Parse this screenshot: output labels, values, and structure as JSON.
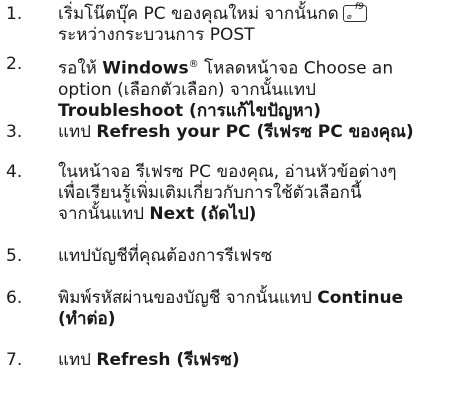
{
  "steps": [
    {
      "number": "1.",
      "lines": [
        {
          "text": "เริ่มโน๊ตบุ๊ค PC ของคุณใหม่ จากนั้นกด"
        },
        {
          "text": "ระหว่างกระบวนการ POST"
        }
      ],
      "key": {
        "label": "f9",
        "symbol": "⌀"
      }
    },
    {
      "number": "2.",
      "lines": [
        {
          "pre": "รอให้ ",
          "bold": "Windows",
          "sup": "®",
          "post": " โหลดหน้าจอ Choose an"
        },
        {
          "text": "option (เลือกตัวเลือก) จากนั้นแทป"
        },
        {
          "bold": "Troubleshoot (การแก้ไขปัญหา)"
        }
      ]
    },
    {
      "number": "3.",
      "lines": [
        {
          "pre": "แทป ",
          "bold": "Refresh your PC (รีเฟรซ PC ของคุณ)"
        }
      ]
    },
    {
      "number": "4.",
      "lines": [
        {
          "text": "ในหน้าจอ รีเฟรซ PC ของคุณ, อ่านหัวข้อต่างๆ"
        },
        {
          "text": "เพื่อเรียนรู้เพิ่มเติมเกี่ยวกับการใช้ตัวเลือกนี้"
        },
        {
          "pre": "จากนั้นแทป ",
          "bold": "Next (ถัดไป)"
        }
      ]
    },
    {
      "number": "5.",
      "lines": [
        {
          "text": "แทปบัญชีที่คุณต้องการรีเฟรซ"
        }
      ]
    },
    {
      "number": "6.",
      "lines": [
        {
          "pre": "พิมพ์รหัสผ่านของบัญชี จากนั้นแทป ",
          "bold": "Continue"
        },
        {
          "bold": "(ทำต่อ)"
        }
      ]
    },
    {
      "number": "7.",
      "lines": [
        {
          "pre": "แทป ",
          "bold": "Refresh (รีเฟรซ)"
        }
      ]
    }
  ]
}
